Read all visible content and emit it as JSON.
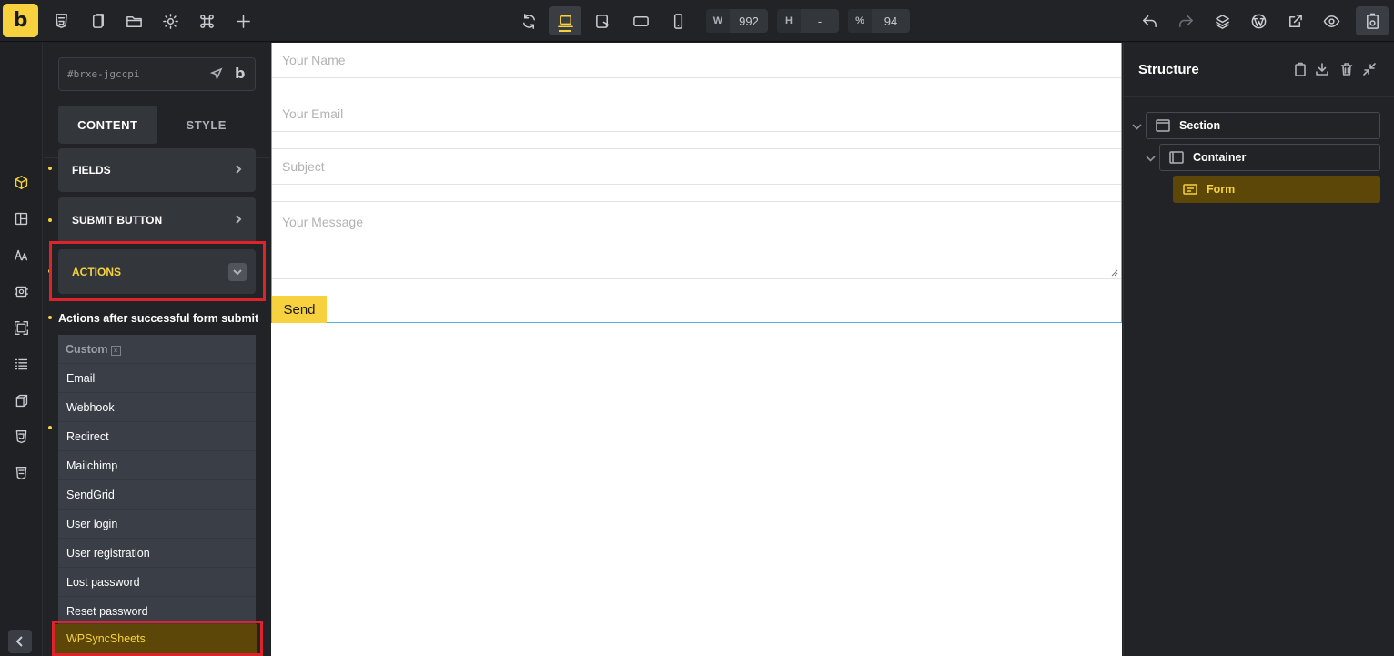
{
  "toolbar": {
    "logo": "b",
    "width_label": "W",
    "width_value": "992",
    "height_label": "H",
    "height_value": "-",
    "zoom_label": "%",
    "zoom_value": "94"
  },
  "panel": {
    "element_id": "#brxe-jgccpi",
    "brand_glyph": "b",
    "tabs": [
      {
        "label": "CONTENT",
        "active": true
      },
      {
        "label": "STYLE",
        "active": false
      }
    ],
    "sections": {
      "fields": "FIELDS",
      "submit_button": "SUBMIT BUTTON",
      "actions": "ACTIONS"
    },
    "actions_label": "Actions after successful form submit",
    "dropdown": {
      "custom_label": "Custom",
      "custom_clear": "×",
      "options": [
        "Email",
        "Webhook",
        "Redirect",
        "Mailchimp",
        "SendGrid",
        "User login",
        "User registration",
        "Lost password",
        "Reset password"
      ],
      "highlighted": "WPSyncSheets"
    }
  },
  "canvas": {
    "fields": {
      "name": "Your Name",
      "email": "Your Email",
      "subject": "Subject",
      "message": "Your Message"
    },
    "send_label": "Send"
  },
  "structure": {
    "title": "Structure",
    "nodes": {
      "section": "Section",
      "container": "Container",
      "form": "Form"
    }
  },
  "colors": {
    "accent": "#f7d23e",
    "highlight_box": "#e0232b",
    "selected_bg": "#5c4708"
  }
}
